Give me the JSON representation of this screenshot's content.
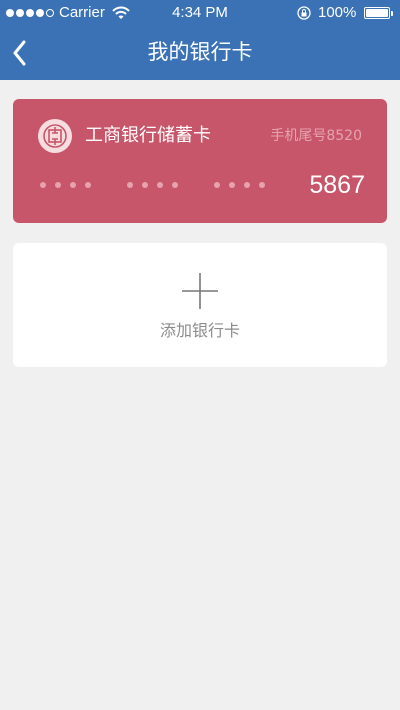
{
  "status_bar": {
    "carrier": "Carrier",
    "time": "4:34 PM",
    "battery": "100%"
  },
  "header": {
    "title": "我的银行卡",
    "back_icon": "chevron-left-icon",
    "background": "#3a72b5"
  },
  "card": {
    "bank_name": "工商银行储蓄卡",
    "phone_tail": "手机尾号8520",
    "last4": "5867",
    "logo_icon": "icbc-logo-icon",
    "color": "#c8566a"
  },
  "add_card": {
    "label": "添加银行卡",
    "icon": "plus-icon"
  }
}
